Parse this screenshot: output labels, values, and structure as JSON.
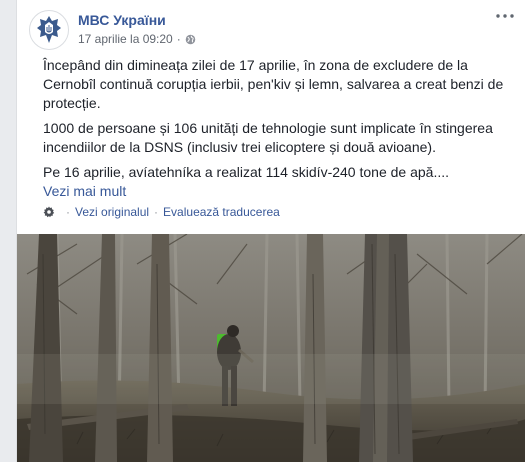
{
  "post": {
    "page_name": "МВС України",
    "timestamp": "17 aprilie la 09:20",
    "separator": "·",
    "paragraphs": [
      "Începând din dimineața zilei de 17 aprilie, în zona de excludere de la Cernobîl continuă corupția ierbii, pen'kiv și lemn, salvarea a creat benzi de protecție.",
      "1000 de persoane și 106 unități de tehnologie sunt implicate în stingerea incendiilor de la DSNS (inclusiv trei elicoptere și două avioane).",
      "Pe 16 aprilie, avíatehníka a realizat 114 skidív-240 tone de apă...."
    ],
    "see_more": "Vezi mai mult",
    "see_original": "Vezi originalul",
    "rate_translation": "Evaluează traducerea",
    "translate_dot": "·"
  },
  "icons": {
    "avatar": "police-emblem-icon",
    "privacy": "globe-icon",
    "menu": "more-dots-icon",
    "settings": "gear-icon"
  },
  "colors": {
    "link": "#385898",
    "text": "#1d2129",
    "meta": "#616770",
    "background": "#e9ebee",
    "emblem": "#3b5a8c"
  }
}
